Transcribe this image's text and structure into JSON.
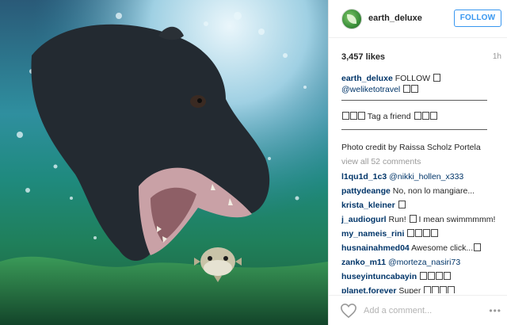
{
  "post": {
    "username": "earth_deluxe",
    "follow_label": "FOLLOW",
    "likes": "3,457 likes",
    "time": "1h"
  },
  "caption": {
    "line1_user": "earth_deluxe",
    "line1_text": " FOLLOW ",
    "line2_mention": "@weliketotravel",
    "line3_text": " Tag a friend ",
    "line4_text": "Photo credit by Raissa Scholz Portela",
    "view_all": "view all 52 comments"
  },
  "comments": [
    {
      "user": "l1qu1d_1c3",
      "text": " @nikki_hollen_x333"
    },
    {
      "user": "pattydeange",
      "text": " No, non lo mangiare..."
    },
    {
      "user": "krista_kleiner",
      "text": ""
    },
    {
      "user": "j_audiogurl",
      "text": " Run! ",
      "text2": " I mean swimmmmm!"
    },
    {
      "user": "my_nameis_rini",
      "text": ""
    },
    {
      "user": "husnainahmed04",
      "text": " Awesome click..."
    },
    {
      "user": "zanko_m11",
      "text": " @morteza_nasiri73"
    },
    {
      "user": "huseyintuncabayin",
      "text": ""
    },
    {
      "user": "planet.forever",
      "text": " Super "
    }
  ],
  "footer": {
    "add_comment_placeholder": "Add a comment...",
    "more_label": "•••"
  },
  "icons": {
    "avatar": "earth-avatar-icon",
    "heart": "heart-icon",
    "more": "more-options-icon"
  },
  "colors": {
    "accent": "#3897f0",
    "username": "#003569",
    "muted": "#999999"
  }
}
